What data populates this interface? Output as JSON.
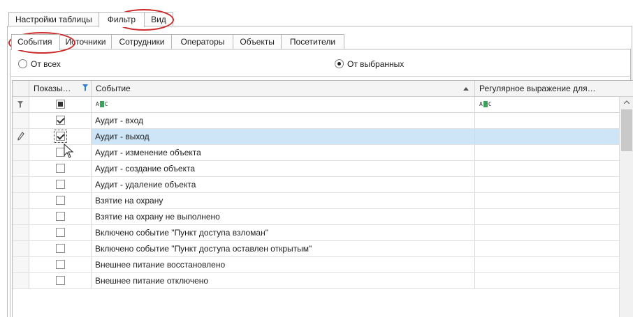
{
  "top_tabs": [
    "Настройки таблицы",
    "Фильтр",
    "Вид"
  ],
  "sub_tabs": [
    "События",
    "Источники",
    "Сотрудники",
    "Операторы",
    "Объекты",
    "Посетители"
  ],
  "radio": {
    "all": "От всех",
    "selected": "От выбранных"
  },
  "columns": {
    "show": "Показы…",
    "event": "Событие",
    "regex": "Регулярное выражение для…"
  },
  "filter_icon": "funnel-icon",
  "rows": [
    {
      "checked": true,
      "label": "Аудит - вход"
    },
    {
      "checked": true,
      "label": "Аудит - выход",
      "selected": true
    },
    {
      "checked": false,
      "label": "Аудит - изменение объекта"
    },
    {
      "checked": false,
      "label": "Аудит - создание объекта"
    },
    {
      "checked": false,
      "label": "Аудит - удаление объекта"
    },
    {
      "checked": false,
      "label": "Взятие на охрану"
    },
    {
      "checked": false,
      "label": "Взятие на охрану не выполнено"
    },
    {
      "checked": false,
      "label": "Включено событие \"Пункт доступа взломан\""
    },
    {
      "checked": false,
      "label": "Включено событие \"Пункт доступа оставлен открытым\""
    },
    {
      "checked": false,
      "label": "Внешнее питание восстановлено"
    },
    {
      "checked": false,
      "label": "Внешнее питание отключено"
    }
  ],
  "highlight_color": "#cc2b2b",
  "selection_color": "#cde5f7"
}
